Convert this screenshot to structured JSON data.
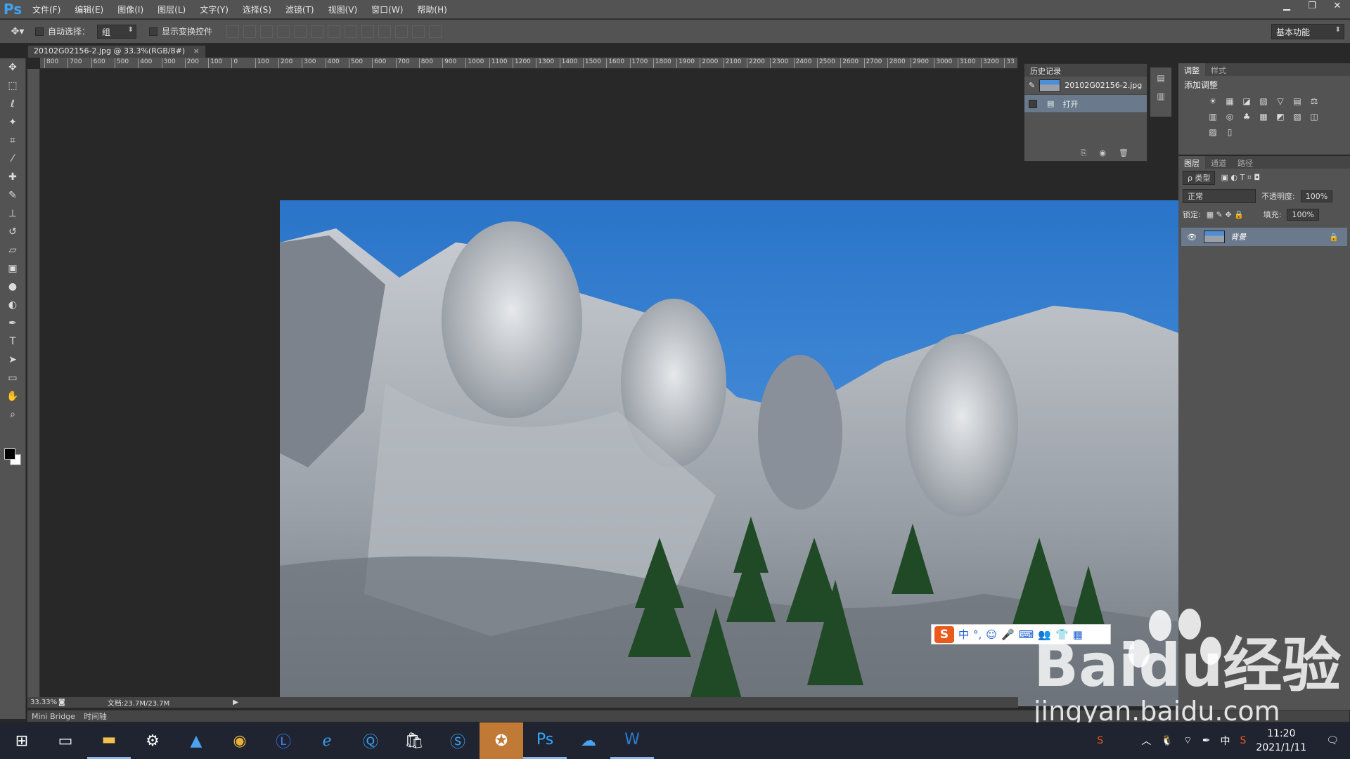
{
  "app": {
    "logo": "Ps"
  },
  "menu": [
    "文件(F)",
    "编辑(E)",
    "图像(I)",
    "图层(L)",
    "文字(Y)",
    "选择(S)",
    "滤镜(T)",
    "视图(V)",
    "窗口(W)",
    "帮助(H)"
  ],
  "window_controls": {
    "minimize": "▁",
    "restore": "❐",
    "close": "✕"
  },
  "options": {
    "auto_select_label": "自动选择：",
    "auto_select_value": "组",
    "transform_label": "显示变换控件",
    "workspace": "基本功能"
  },
  "document": {
    "tab_title": "20102G02156-2.jpg @ 33.3%(RGB/8#)",
    "close": "×"
  },
  "ruler": {
    "h_ticks": [
      "800",
      "700",
      "600",
      "500",
      "400",
      "300",
      "200",
      "100",
      "0",
      "100",
      "200",
      "300",
      "400",
      "500",
      "600",
      "700",
      "800",
      "900",
      "1000",
      "1100",
      "1200",
      "1300",
      "1400",
      "1500",
      "1600",
      "1700",
      "1800",
      "1900",
      "2000",
      "2100",
      "2200",
      "2300",
      "2400",
      "2500",
      "2600",
      "2700",
      "2800",
      "2900",
      "3000",
      "3100",
      "3200",
      "33"
    ]
  },
  "status": {
    "zoom": "33.33%",
    "doc": "文档:23.7M/23.7M"
  },
  "bottom_tabs": [
    "Mini Bridge",
    "时间轴"
  ],
  "history": {
    "tab": "历史记录",
    "snapshot": "20102G02156-2.jpg",
    "step": "打开"
  },
  "adjustments": {
    "tabs": [
      "调整",
      "样式"
    ],
    "title": "添加调整",
    "icons": [
      "☀",
      "▦",
      "◪",
      "▨",
      "▽",
      "▤",
      "⚖",
      "▥",
      "◎",
      "♣",
      "▦",
      "◩",
      "▧",
      "◫",
      "▨",
      "▯"
    ]
  },
  "layers": {
    "tabs": [
      "图层",
      "通道",
      "路径"
    ],
    "filter_label": "ρ 类型",
    "blend_mode": "正常",
    "opacity_label": "不透明度:",
    "opacity_value": "100%",
    "lock_label": "锁定:",
    "fill_label": "填充:",
    "fill_value": "100%",
    "layer_name": "背景"
  },
  "ime": {
    "brand": "S",
    "items": [
      "中",
      "°,",
      "☺",
      "🎤",
      "⌨",
      "👥",
      "👕",
      "▦"
    ]
  },
  "watermark": {
    "logo": "Baidu经验",
    "url": "jingyan.baidu.com"
  },
  "taskbar": {
    "icons": [
      "start-icon",
      "task-view-icon",
      "file-explorer-icon",
      "settings-icon",
      "photos-icon",
      "chrome-icon",
      "l-app-icon",
      "ie-icon",
      "q-app-icon",
      "store-icon",
      "sogou-app-icon",
      "seal-app-icon",
      "photoshop-icon",
      "baidu-netdisk-icon",
      "word-icon"
    ],
    "tray_ime": "中",
    "time": "11:20",
    "date": "2021/1/11"
  }
}
